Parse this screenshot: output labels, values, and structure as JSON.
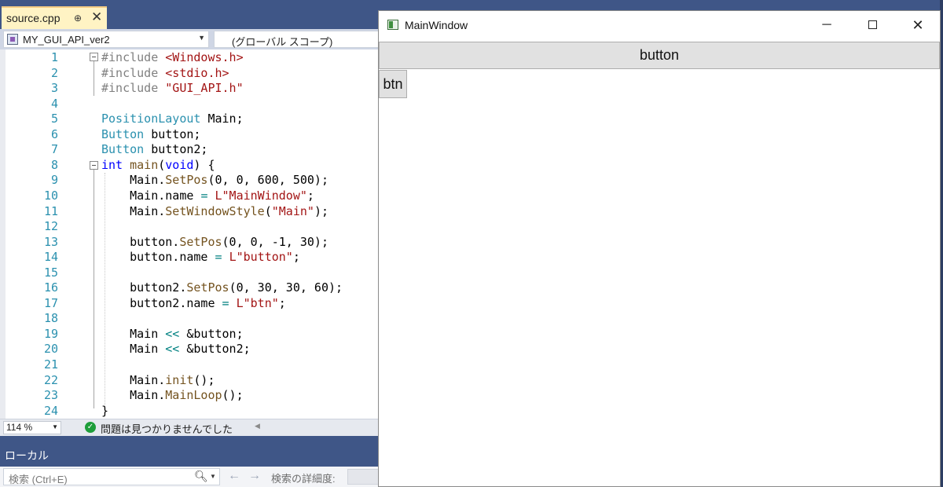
{
  "ide": {
    "tab": {
      "label": "source.cpp",
      "pin_glyph": "⊕",
      "close_glyph": "✕"
    },
    "nav": {
      "project": "MY_GUI_API_ver2",
      "scope": "(グローバル スコープ)"
    },
    "code_lines": [
      {
        "n": "1",
        "html": "<span class=\"pp\">#include</span> <span class=\"str\">&lt;Windows.h&gt;</span>"
      },
      {
        "n": "2",
        "html": "<span class=\"pp\">#include</span> <span class=\"str\">&lt;stdio.h&gt;</span>"
      },
      {
        "n": "3",
        "html": "<span class=\"pp\">#include</span> <span class=\"str\">\"GUI_API.h\"</span>"
      },
      {
        "n": "4",
        "html": ""
      },
      {
        "n": "5",
        "html": "<span class=\"ty\">PositionLayout</span> Main;"
      },
      {
        "n": "6",
        "html": "<span class=\"ty\">Button</span> button;"
      },
      {
        "n": "7",
        "html": "<span class=\"ty\">Button</span> button2;"
      },
      {
        "n": "8",
        "html": "<span class=\"kw\">int</span> <span class=\"fn\">main</span>(<span class=\"kw\">void</span>) {"
      },
      {
        "n": "9",
        "html": "    Main.<span class=\"fn\">SetPos</span>(0, 0, 600, 500);"
      },
      {
        "n": "10",
        "html": "    Main.name <span class=\"op\">=</span> <span class=\"str\">L\"MainWindow\"</span>;"
      },
      {
        "n": "11",
        "html": "    Main.<span class=\"fn\">SetWindowStyle</span>(<span class=\"str\">\"Main\"</span>);"
      },
      {
        "n": "12",
        "html": ""
      },
      {
        "n": "13",
        "html": "    button.<span class=\"fn\">SetPos</span>(0, 0, -1, 30);"
      },
      {
        "n": "14",
        "html": "    button.name <span class=\"op\">=</span> <span class=\"str\">L\"button\"</span>;"
      },
      {
        "n": "15",
        "html": ""
      },
      {
        "n": "16",
        "html": "    button2.<span class=\"fn\">SetPos</span>(0, 30, 30, 60);"
      },
      {
        "n": "17",
        "html": "    button2.name <span class=\"op\">=</span> <span class=\"str\">L\"btn\"</span>;"
      },
      {
        "n": "18",
        "html": ""
      },
      {
        "n": "19",
        "html": "    Main <span class=\"op\">&lt;&lt;</span> &amp;button;"
      },
      {
        "n": "20",
        "html": "    Main <span class=\"op\">&lt;&lt;</span> &amp;button2;"
      },
      {
        "n": "21",
        "html": ""
      },
      {
        "n": "22",
        "html": "    Main.<span class=\"fn\">init</span>();"
      },
      {
        "n": "23",
        "html": "    Main.<span class=\"fn\">MainLoop</span>();"
      },
      {
        "n": "24",
        "html": "}"
      }
    ],
    "status": {
      "zoom": "114 %",
      "issues": "問題は見つかりませんでした"
    },
    "locals": {
      "title": "ローカル",
      "search_placeholder": "検索 (Ctrl+E)",
      "depth_label": "検索の詳細度:"
    }
  },
  "mainwindow": {
    "title": "MainWindow",
    "minimize_glyph": "─",
    "close_glyph": "✕",
    "button_label": "button",
    "btn_label": "btn"
  },
  "colors": {
    "ide_chrome": "#3f5687",
    "tab_active": "#fff3c4",
    "keyword": "#0000ff",
    "type": "#2b91af",
    "string": "#a31515",
    "function": "#74531f",
    "line_number": "#2b91af"
  }
}
